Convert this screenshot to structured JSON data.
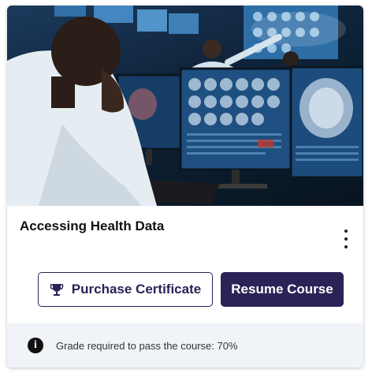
{
  "course": {
    "title": "Accessing Health Data",
    "image_alt": "Medical professionals reviewing brain scans on multiple monitors"
  },
  "actions": {
    "purchase_label": "Purchase Certificate",
    "resume_label": "Resume Course",
    "more_menu_icon": "kebab-vertical-icon",
    "purchase_icon": "trophy-icon"
  },
  "footer": {
    "info_icon": "info-icon",
    "info_glyph": "i",
    "grade_text": "Grade required to pass the course: 70%"
  },
  "colors": {
    "brand": "#2a2356",
    "footer_bg": "#f0f4f8",
    "card_bg": "#ffffff"
  }
}
